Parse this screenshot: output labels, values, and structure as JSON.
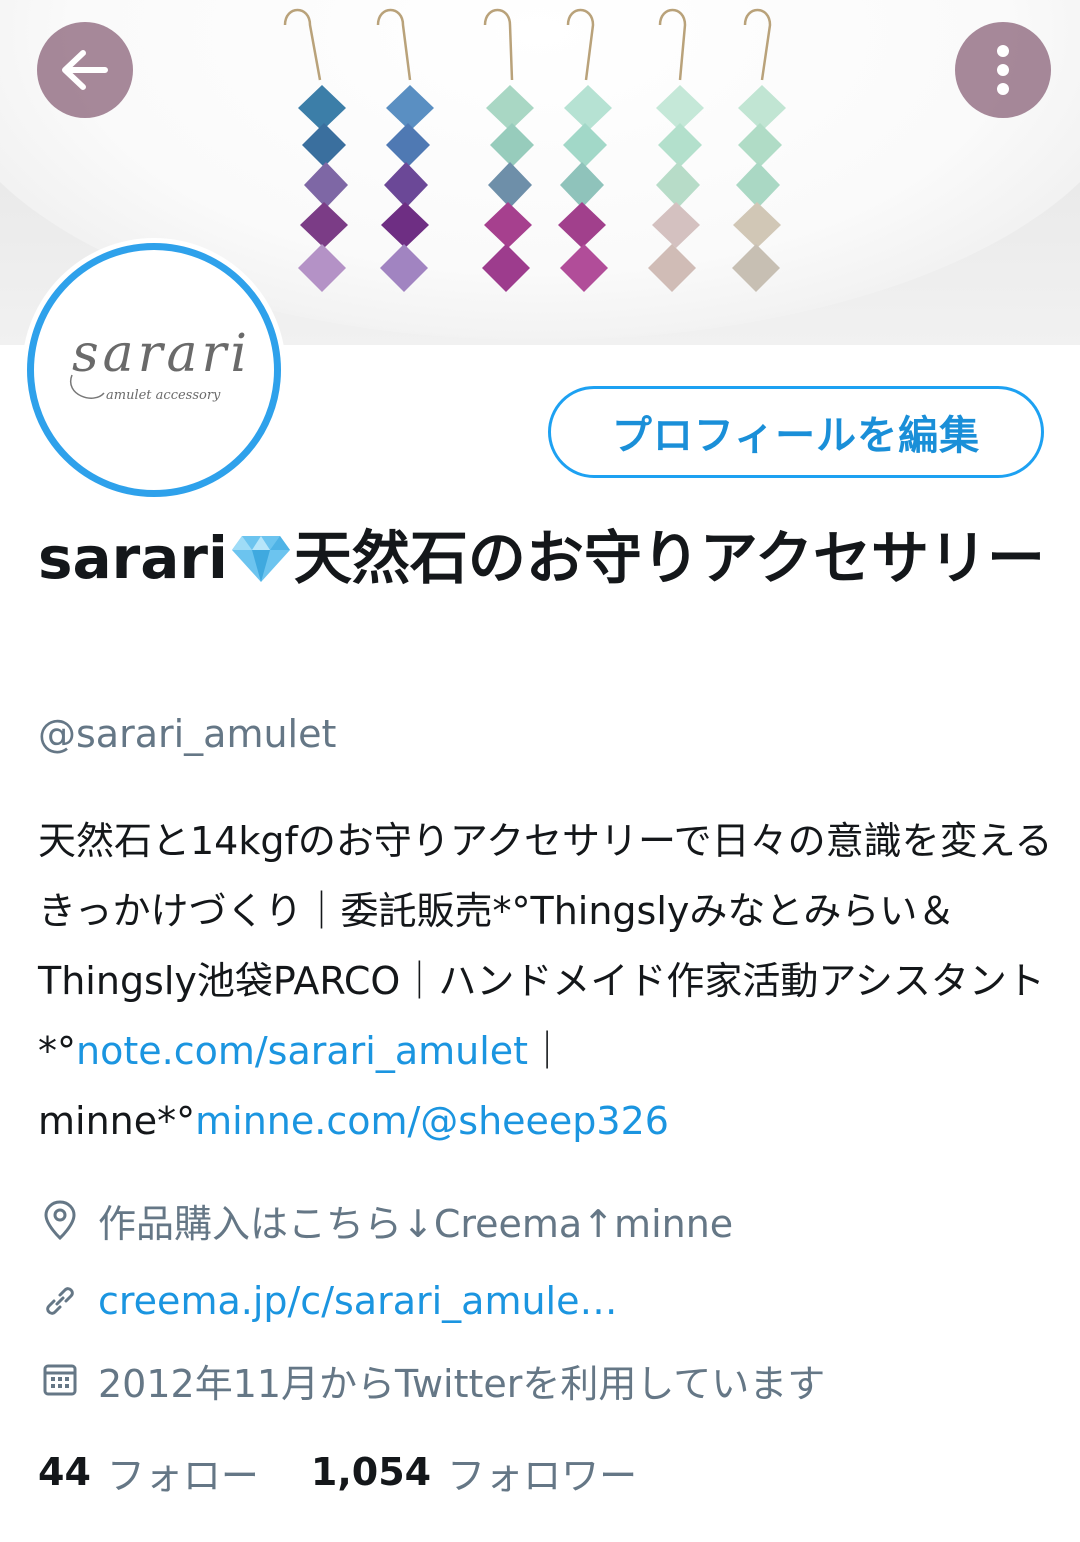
{
  "header": {
    "back_icon": "arrow-left-icon",
    "more_icon": "more-vertical-icon",
    "overlay_color": "#96738766"
  },
  "avatar": {
    "logo_text": "sarari",
    "logo_subtext": "amulet accessory",
    "ring_color": "#2ea1eb"
  },
  "edit_profile_label": "プロフィールを編集",
  "profile": {
    "name_part1": "sarari",
    "name_emoji": "gem-icon",
    "name_part2": "天然石のお守りアクセサリー",
    "handle": "@sarari_amulet",
    "bio": {
      "text1": "天然石と14kgfのお守りアクセサリーで日々の意識を変えるきっかけづくり｜委託販売*°Thingslyみなとみらい＆Thingsly池袋PARCO｜ハンドメイド作家活動アシスタント*°",
      "link1": "note.com/sarari_amulet",
      "text2": "｜minne*°",
      "link2": "minne.com/@sheeep326"
    },
    "location": "作品購入はこちら↓Creema↑minne",
    "url": "creema.jp/c/sarari_amule…",
    "joined": "2012年11月からTwitterを利用しています"
  },
  "stats": {
    "following_count": "44",
    "following_label": "フォロー",
    "followers_count": "1,054",
    "followers_label": "フォロワー"
  },
  "colors": {
    "accent": "#1da1f2",
    "link": "#1b95e0",
    "secondary_text": "#657786",
    "primary_text": "#14171a"
  }
}
